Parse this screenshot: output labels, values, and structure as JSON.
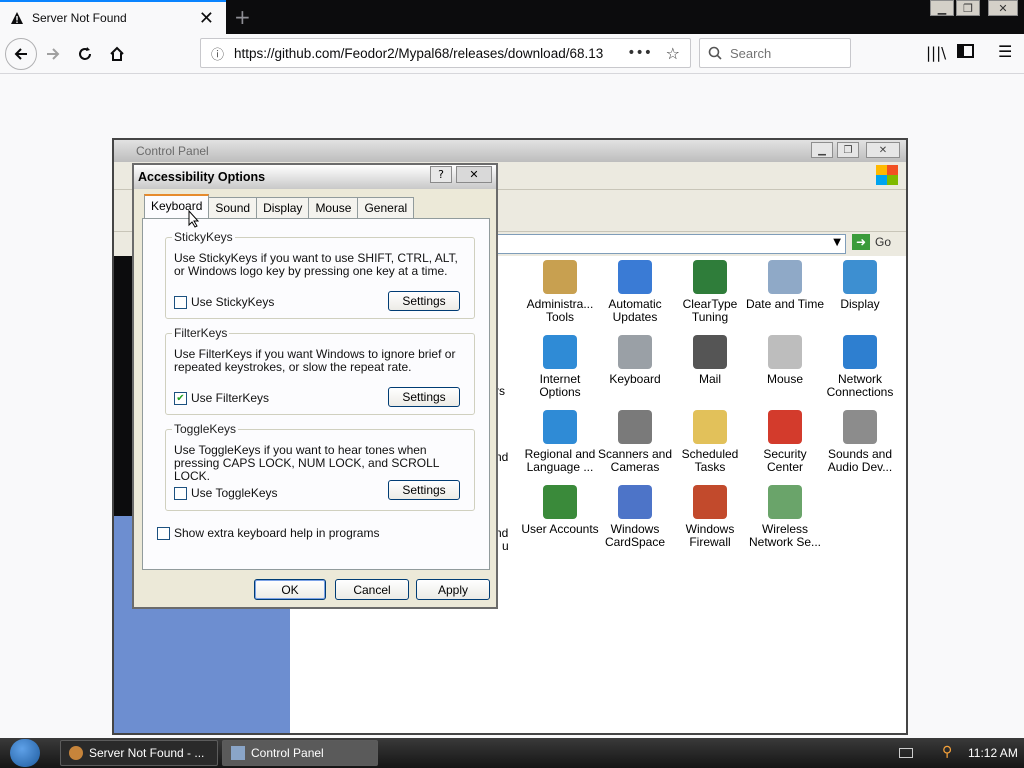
{
  "browser": {
    "tab_title": "Server Not Found",
    "url": "https://github.com/Feodor2/Mypal68/releases/download/68.13",
    "search_placeholder": "Search"
  },
  "control_panel": {
    "title": "Control Panel",
    "go_label": "Go",
    "icons": [
      {
        "label": "Administra... Tools",
        "icon": "admin-tools-icon",
        "color": "#c8a050"
      },
      {
        "label": "Automatic Updates",
        "icon": "windows-flag-icon",
        "color": "#3a7bd5"
      },
      {
        "label": "ClearType Tuning",
        "icon": "cleartype-icon",
        "color": "#2f7d3a"
      },
      {
        "label": "Date and Time",
        "icon": "clock-icon",
        "color": "#8fa9c7"
      },
      {
        "label": "Display",
        "icon": "display-icon",
        "color": "#3d8fd1"
      },
      {
        "label": "Internet Options",
        "icon": "globe-icon",
        "color": "#2f8bd6"
      },
      {
        "label": "Keyboard",
        "icon": "keyboard-icon",
        "color": "#9aa0a6"
      },
      {
        "label": "Mail",
        "icon": "mail-icon",
        "color": "#555"
      },
      {
        "label": "Mouse",
        "icon": "mouse-icon",
        "color": "#bdbdbd"
      },
      {
        "label": "Network Connections",
        "icon": "network-icon",
        "color": "#2e7fd0"
      },
      {
        "label": "Regional and Language ...",
        "icon": "globe-icon",
        "color": "#2f8bd6"
      },
      {
        "label": "Scanners and Cameras",
        "icon": "camera-icon",
        "color": "#7a7a7a"
      },
      {
        "label": "Scheduled Tasks",
        "icon": "folder-clock-icon",
        "color": "#e2c15a"
      },
      {
        "label": "Security Center",
        "icon": "shield-icon",
        "color": "#d33b2c"
      },
      {
        "label": "Sounds and Audio Dev...",
        "icon": "speaker-icon",
        "color": "#8c8c8c"
      },
      {
        "label": "User Accounts",
        "icon": "users-icon",
        "color": "#3a8a3a"
      },
      {
        "label": "Windows CardSpace",
        "icon": "cardspace-icon",
        "color": "#4d74c8"
      },
      {
        "label": "Windows Firewall",
        "icon": "firewall-icon",
        "color": "#c24a2c"
      },
      {
        "label": "Wireless Network Se...",
        "icon": "wireless-icon",
        "color": "#6aa46a"
      }
    ],
    "partial_labels": [
      "rs",
      "nd",
      "nd",
      "u"
    ]
  },
  "dialog": {
    "title": "Accessibility Options",
    "tabs": [
      "Keyboard",
      "Sound",
      "Display",
      "Mouse",
      "General"
    ],
    "active_tab": "Keyboard",
    "sticky": {
      "caption": "StickyKeys",
      "description": "Use StickyKeys if you want to use SHIFT, CTRL, ALT, or Windows logo key by pressing one key at a time.",
      "checkbox_label": "Use StickyKeys",
      "checked": false,
      "settings_label": "Settings"
    },
    "filter": {
      "caption": "FilterKeys",
      "description": "Use FilterKeys if you want Windows to ignore brief or repeated keystrokes, or slow the repeat rate.",
      "checkbox_label": "Use FilterKeys",
      "checked": true,
      "settings_label": "Settings"
    },
    "toggle": {
      "caption": "ToggleKeys",
      "description": "Use ToggleKeys if you want to hear tones when pressing CAPS LOCK, NUM LOCK, and SCROLL LOCK.",
      "checkbox_label": "Use ToggleKeys",
      "checked": false,
      "settings_label": "Settings"
    },
    "extra_help_label": "Show extra keyboard help in programs",
    "ok_label": "OK",
    "cancel_label": "Cancel",
    "apply_label": "Apply"
  },
  "taskbar": {
    "tasks": [
      "Server Not Found - ...",
      "Control Panel"
    ],
    "time": "11:12 AM"
  }
}
